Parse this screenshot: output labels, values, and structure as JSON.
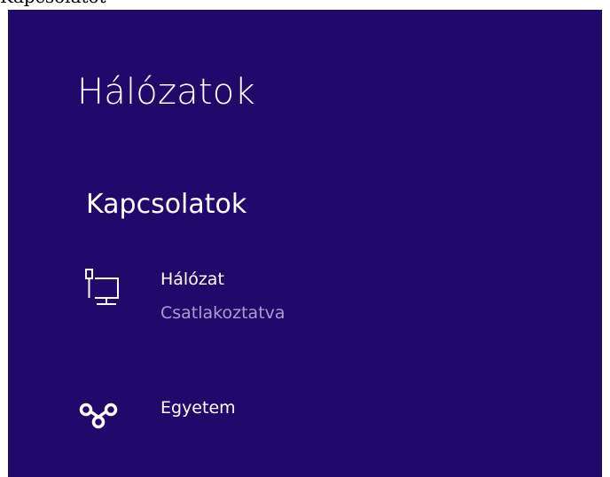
{
  "caption": "Kapcsolatot",
  "panel": {
    "title": "Hálózatok",
    "background": "#21086b"
  },
  "connections": {
    "title": "Kapcsolatok",
    "items": [
      {
        "icon": "wired-network-icon",
        "name": "Hálózat",
        "status": "Csatlakoztatva"
      },
      {
        "icon": "vpn-icon",
        "name": "Egyetem"
      }
    ]
  }
}
